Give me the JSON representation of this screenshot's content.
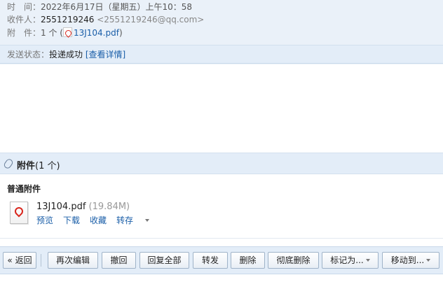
{
  "header": {
    "time_label": "时　间：",
    "time_value": "2022年6月17日（星期五）上午10：58",
    "to_label": "收件人：",
    "to_name": "2551219246",
    "to_email": "<2551219246@qq.com>",
    "attach_label": "附　件：",
    "attach_count": "1 个 (",
    "attach_file": "13J104.pdf",
    "attach_close": ")"
  },
  "status": {
    "label": "发送状态：",
    "value": "投递成功",
    "link": "[查看详情]"
  },
  "attachments": {
    "title": "附件",
    "count": "(1 个)",
    "section_label": "普通附件",
    "file_name": "13J104.pdf",
    "file_size": "(19.84M)",
    "actions": [
      "预览",
      "下载",
      "收藏",
      "转存"
    ]
  },
  "toolbar": {
    "back": "« 返回",
    "edit_again": "再次编辑",
    "recall": "撤回",
    "reply_all": "回复全部",
    "forward": "转发",
    "delete": "删除",
    "delete_perm": "彻底删除",
    "mark_as": "标记为...",
    "move_to": "移动到..."
  },
  "colors": {
    "header_bg": "#eaf1f9",
    "bar_bg": "#e3edf8",
    "link": "#1a5ea8",
    "pdf_red": "#d9251c"
  }
}
